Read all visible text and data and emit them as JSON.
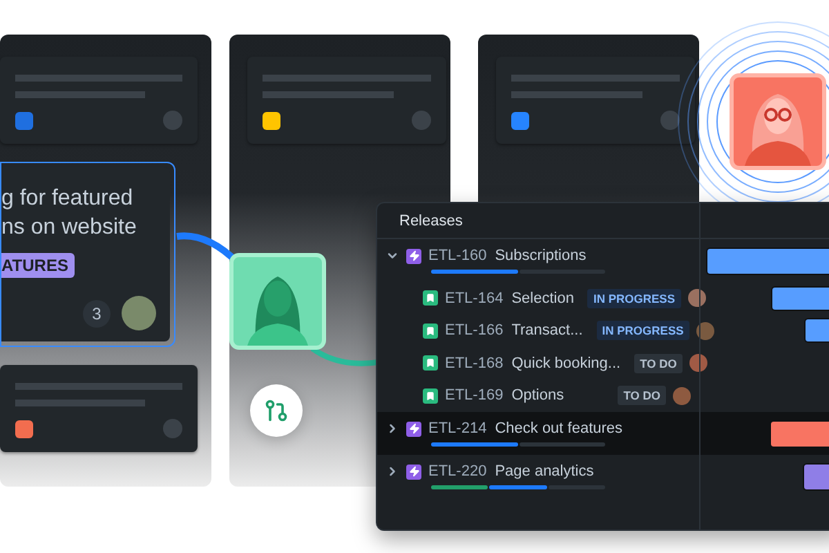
{
  "board": {
    "columns": [
      {
        "cards": [
          {
            "kind": "placeholder",
            "color": "#1f6fe0"
          },
          {
            "kind": "feature",
            "selected": true,
            "title": "g for featured\nns on website",
            "tag": "ATURES",
            "count": "3"
          },
          {
            "kind": "placeholder",
            "color": "#f26d4f"
          }
        ]
      },
      {
        "cards": [
          {
            "kind": "placeholder",
            "color": "#ffc400"
          }
        ]
      },
      {
        "cards": [
          {
            "kind": "placeholder",
            "color": "#2684ff"
          }
        ]
      }
    ]
  },
  "releases": {
    "title": "Releases",
    "epics": [
      {
        "key": "ETL-160",
        "name": "Subscriptions",
        "expanded": true,
        "selected": false,
        "progress": [
          {
            "color": "#1d7afc"
          },
          {
            "color": "#2c333a"
          }
        ],
        "bar": {
          "color": "#579dff",
          "level": 0.95
        },
        "children": [
          {
            "key": "ETL-164",
            "name": "Selection",
            "status": {
              "label": "IN PROGRESS",
              "kind": "progress"
            },
            "bar": {
              "color": "#579dff",
              "level": 0.5
            }
          },
          {
            "key": "ETL-166",
            "name": "Transact...",
            "status": {
              "label": "IN PROGRESS",
              "kind": "progress"
            },
            "bar": {
              "color": "#579dff",
              "level": 0.27
            }
          },
          {
            "key": "ETL-168",
            "name": "Quick booking...",
            "status": {
              "label": "TO DO",
              "kind": "todo"
            }
          },
          {
            "key": "ETL-169",
            "name": "Options",
            "status": {
              "label": "TO DO",
              "kind": "todo"
            }
          }
        ]
      },
      {
        "key": "ETL-214",
        "name": "Check out features",
        "expanded": false,
        "selected": true,
        "progress": [
          {
            "color": "#1d7afc"
          },
          {
            "color": "#2c333a"
          }
        ],
        "bar": {
          "color": "#f87462",
          "level": 0.51
        }
      },
      {
        "key": "ETL-220",
        "name": "Page analytics",
        "expanded": false,
        "selected": false,
        "progress": [
          {
            "color": "#22a06b"
          },
          {
            "color": "#1d7afc"
          },
          {
            "color": "#2c333a"
          }
        ],
        "bar": {
          "color": "#8f7ee7",
          "level": 0.28
        }
      }
    ]
  }
}
